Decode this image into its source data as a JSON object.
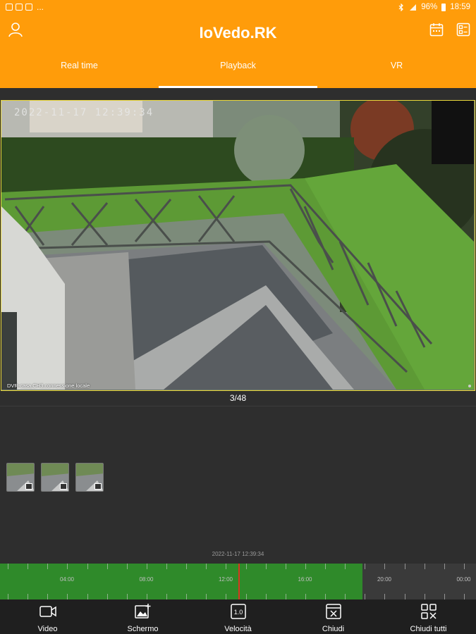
{
  "status_bar": {
    "left_icons": [
      "notification-icon",
      "notification-icon",
      "notification-icon"
    ],
    "more": "...",
    "battery_percent": "96%",
    "time": "18:59"
  },
  "app_bar": {
    "title": "IoVedo.RK",
    "tabs": [
      {
        "label": "Real time",
        "active": false
      },
      {
        "label": "Playback",
        "active": true
      },
      {
        "label": "VR",
        "active": false
      }
    ]
  },
  "video": {
    "osd_timestamp": "2022-11-17 12:39:34",
    "caption": "DVR-casa,CH3,connessione locale"
  },
  "page_counter": "3/48",
  "thumbnails": [
    {
      "name": "recording-1"
    },
    {
      "name": "recording-2"
    },
    {
      "name": "recording-3"
    }
  ],
  "timeline": {
    "current_time": "2022-11-17 12:39:34",
    "labels": [
      "04:00",
      "08:00",
      "12:00",
      "16:00",
      "20:00",
      "00:00"
    ],
    "recorded_fraction": 0.762,
    "cursor_fraction": 0.5
  },
  "toolbar": {
    "video_label": "Video",
    "screenshot_label": "Schermo",
    "speed_label": "Velocità",
    "speed_value": "1.0",
    "close_label": "Chiudi",
    "close_all_label": "Chiudi tutti"
  },
  "colors": {
    "accent": "#ff9c0a",
    "timeline_recorded": "#2f8a2a",
    "cursor": "#d9351f",
    "video_border": "#e9d73a"
  }
}
